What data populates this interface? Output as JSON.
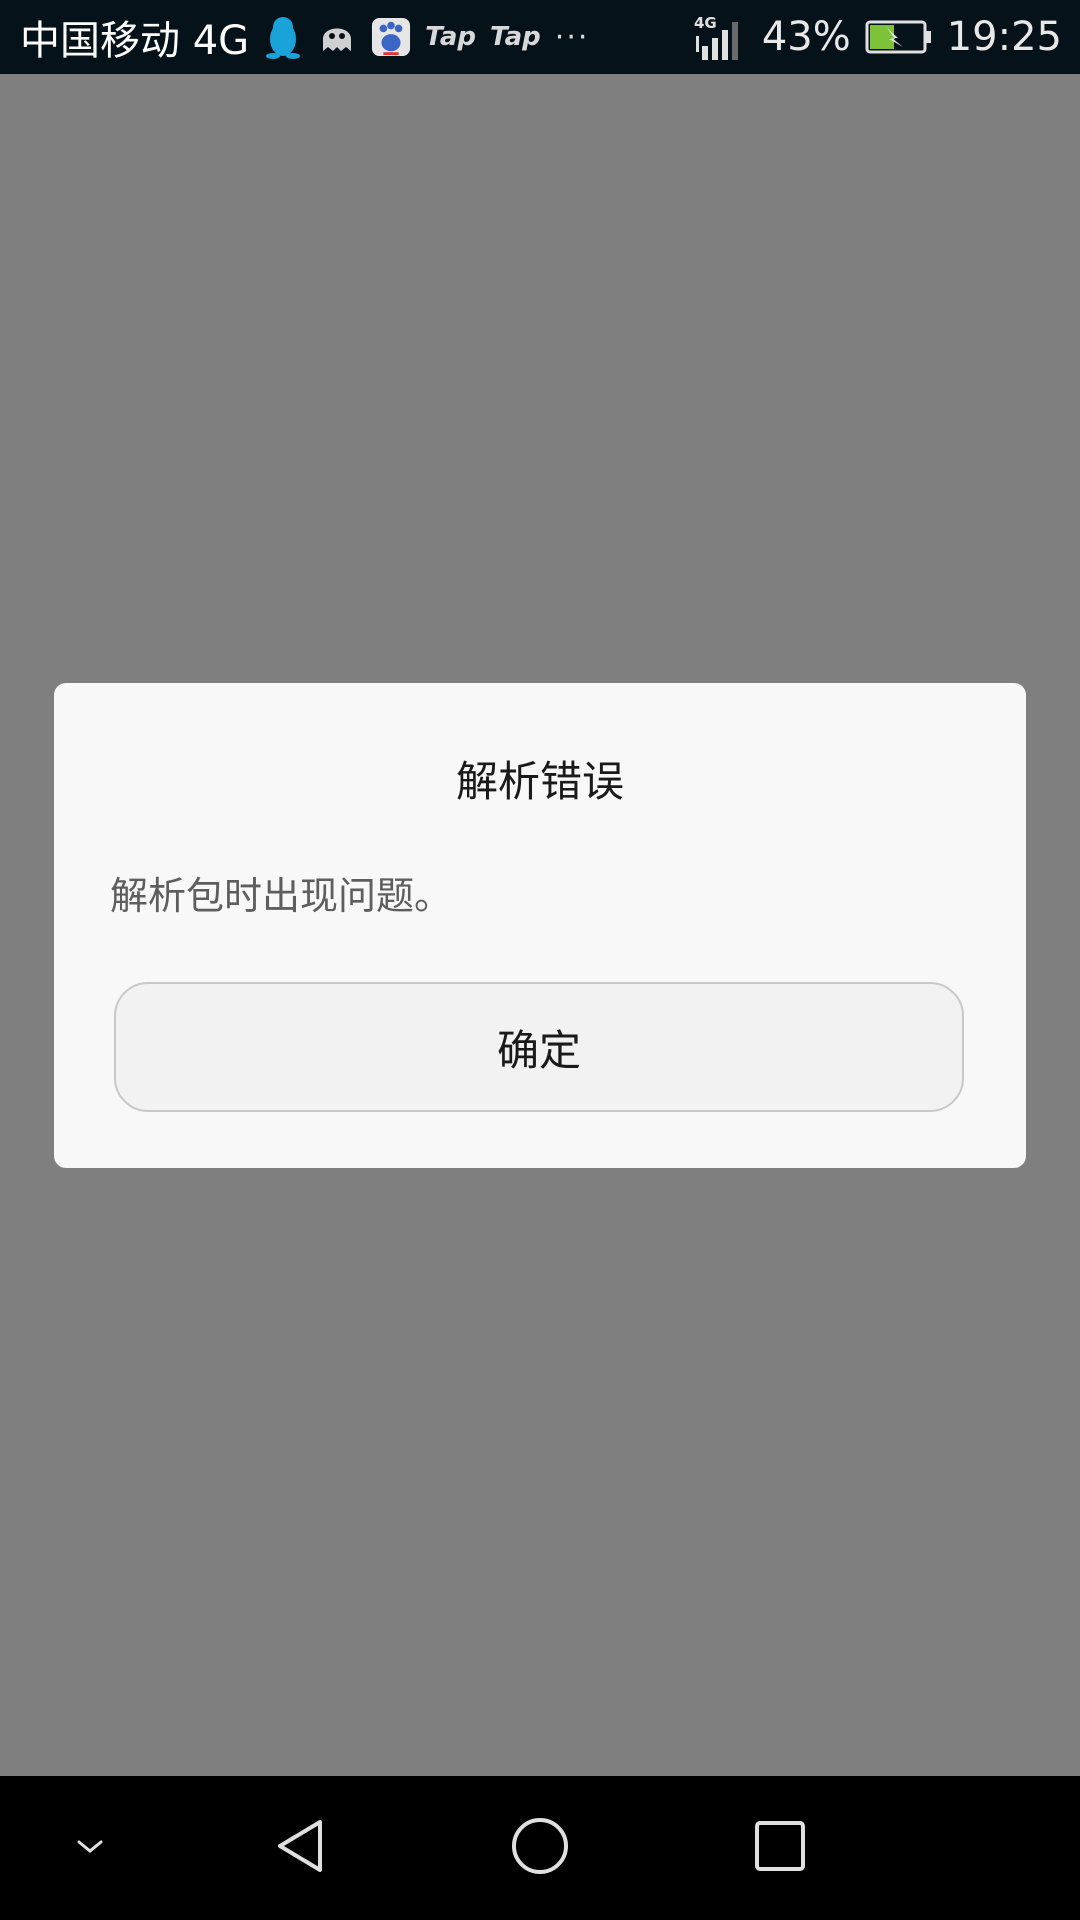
{
  "status_bar": {
    "carrier": "中国移动 4G",
    "notifications": {
      "tap1": "Tap",
      "tap2": "Tap",
      "more": "···"
    },
    "network_label": "4G",
    "battery_percent": "43%",
    "time": "19:25"
  },
  "dialog": {
    "title": "解析错误",
    "message": "解析包时出现问题。",
    "confirm_label": "确定"
  },
  "colors": {
    "scrim": "#7f7f7f",
    "dialog_bg": "#f8f8f8",
    "status_bar_bg": "#06121a",
    "battery_fill": "#7ec23a"
  },
  "nav_bar": {
    "icons": [
      "chevron-down-icon",
      "back-triangle-icon",
      "home-circle-icon",
      "recents-square-icon"
    ]
  }
}
